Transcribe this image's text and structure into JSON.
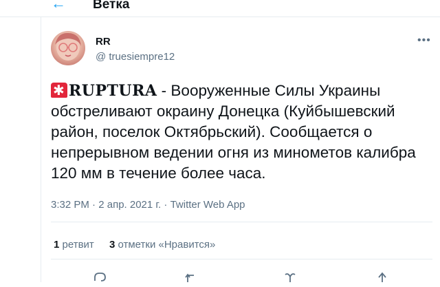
{
  "header": {
    "back_icon": "arrow-left-icon",
    "title": "Ветка"
  },
  "tweet": {
    "author": {
      "name": "RR",
      "handle": "@ truesiempre12"
    },
    "menu_icon": "more-dots-icon",
    "brand": "RUPTURA",
    "brand_icon": "siren-icon",
    "text": " - Вооруженные Силы Украины обстреливают окраину Донецка (Куйбышевский район, поселок Октябрьский). Сообщается о непрерывном ведении огня из минометов калибра 120 мм в течение более часа.",
    "time": "3:32 PM",
    "date": "2 апр. 2021 г.",
    "source": "Twitter Web App",
    "separator": " · "
  },
  "stats": {
    "retweets_count": "1",
    "retweets_label": "ретвит",
    "likes_count": "3",
    "likes_label": "отметки «Нравится»"
  },
  "actions": [
    "reply-icon",
    "retweet-icon",
    "like-icon",
    "share-icon"
  ],
  "colors": {
    "accent": "#1da1f2",
    "text": "#0f1419",
    "muted": "#5b7083",
    "border": "#e6ecf0",
    "siren": "#e2263b"
  }
}
